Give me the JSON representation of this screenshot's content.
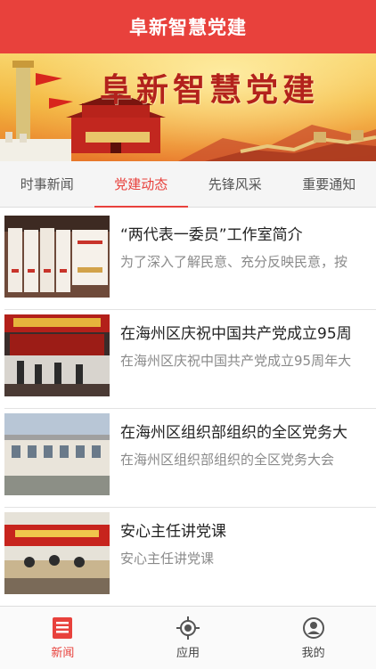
{
  "app": {
    "title": "阜新智慧党建"
  },
  "banner": {
    "title": "阜新智慧党建"
  },
  "tabs": [
    {
      "label": "时事新闻",
      "active": false
    },
    {
      "label": "党建动态",
      "active": true
    },
    {
      "label": "先锋风采",
      "active": false
    },
    {
      "label": "重要通知",
      "active": false
    }
  ],
  "news": [
    {
      "title": "“两代表一委员”工作室简介",
      "summary": "为了深入了解民意、充分反映民意，按"
    },
    {
      "title": "在海州区庆祝中国共产党成立95周",
      "summary": "在海州区庆祝中国共产党成立95周年大"
    },
    {
      "title": "在海州区组织部组织的全区党务大",
      "summary": "在海州区组织部组织的全区党务大会"
    },
    {
      "title": "安心主任讲党课",
      "summary": "安心主任讲党课"
    }
  ],
  "bottom_nav": [
    {
      "label": "新闻",
      "icon": "news-icon",
      "active": true
    },
    {
      "label": "应用",
      "icon": "app-icon",
      "active": false
    },
    {
      "label": "我的",
      "icon": "profile-icon",
      "active": false
    }
  ],
  "colors": {
    "accent": "#e8413c",
    "banner_text": "#b3221c"
  }
}
